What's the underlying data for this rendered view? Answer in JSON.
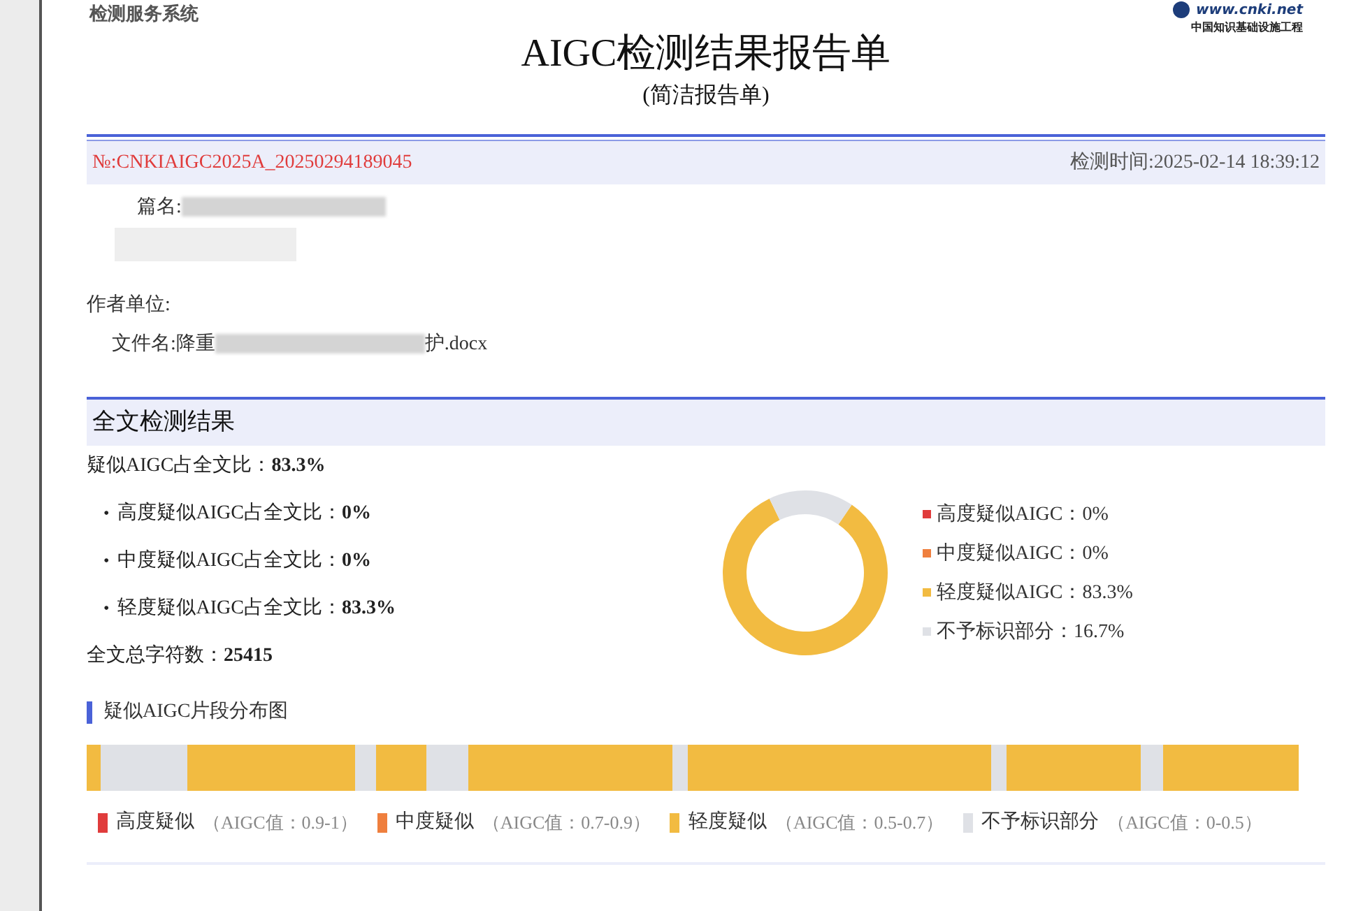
{
  "header": {
    "system_name": "检测服务系统",
    "logo_url": "www.cnki.net",
    "logo_caption": "中国知识基础设施工程"
  },
  "title": "AIGC检测结果报告单",
  "subtitle": "(简洁报告单)",
  "report_bar": {
    "number": "№:CNKIAIGC2025A_20250294189045",
    "time": "检测时间:2025-02-14 18:39:12"
  },
  "fields": [
    {
      "label": "篇名:"
    },
    {
      "label": "作者单位:"
    },
    {
      "label": "文件名:",
      "prefix": "降重",
      "suffix": "护.docx"
    }
  ],
  "section_title": "全文检测结果",
  "summary": {
    "label": "疑似AIGC占全文比：",
    "value": "83.3%"
  },
  "breakdown": [
    {
      "bullet": "•",
      "label": "高度疑似AIGC占全文比：",
      "value": "0%"
    },
    {
      "bullet": "•",
      "label": "中度疑似AIGC占全文比：",
      "value": "0%"
    },
    {
      "bullet": "•",
      "label": "轻度疑似AIGC占全文比：",
      "value": "83.3%"
    }
  ],
  "total": {
    "label": "全文总字符数：",
    "value": "25415"
  },
  "chart_data": {
    "type": "donut",
    "values": [
      0,
      0,
      83.3,
      16.7
    ],
    "colors": [
      "#e03c3c",
      "#ef7f3e",
      "#f2bb41",
      "#dfe1e6"
    ],
    "value_labels": [
      "高度疑似AIGC：0%",
      "中度疑似AIGC：0%",
      "轻度疑似AIGC：83.3%",
      "不予标识部分：16.7%"
    ]
  },
  "distribution": {
    "title": "疑似AIGC片段分布图",
    "legend": [
      {
        "label": "高度疑似",
        "range": "（AIGC值：0.9-1）",
        "color": "#e03c3c"
      },
      {
        "label": "中度疑似",
        "range": "（AIGC值：0.7-0.9）",
        "color": "#ef7f3e"
      },
      {
        "label": "轻度疑似",
        "range": "（AIGC值：0.5-0.7）",
        "color": "#f2bb41"
      },
      {
        "label": "不予标识部分",
        "range": "（AIGC值：0-0.5）",
        "color": "#dfe1e6"
      }
    ]
  }
}
